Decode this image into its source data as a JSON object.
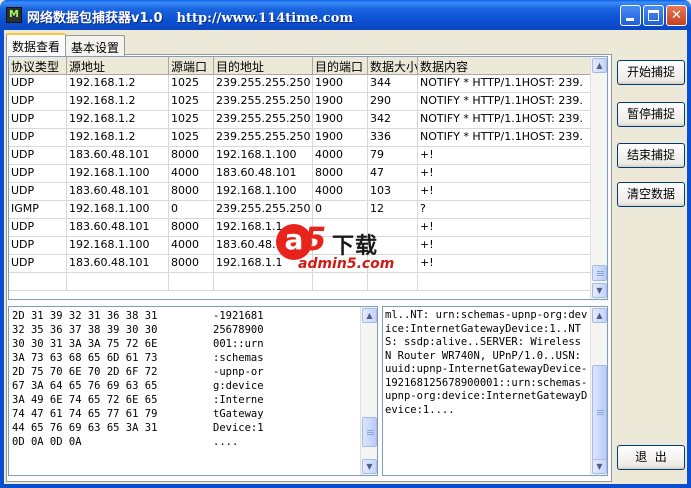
{
  "window": {
    "title": "网络数据包捕获器v1.0",
    "title_url": "http://www.114time.com",
    "icon_glyph": "M"
  },
  "tabs": [
    {
      "label": "数据查看",
      "active": true
    },
    {
      "label": "基本设置",
      "active": false
    }
  ],
  "table": {
    "columns": [
      "协议类型",
      "源地址",
      "源端口",
      "目的地址",
      "目的端口",
      "数据大小",
      "数据内容"
    ],
    "rows": [
      [
        "UDP",
        "192.168.1.2",
        "1025",
        "239.255.255.250",
        "1900",
        "344",
        "NOTIFY * HTTP/1.1HOST: 239."
      ],
      [
        "UDP",
        "192.168.1.2",
        "1025",
        "239.255.255.250",
        "1900",
        "290",
        "NOTIFY * HTTP/1.1HOST: 239."
      ],
      [
        "UDP",
        "192.168.1.2",
        "1025",
        "239.255.255.250",
        "1900",
        "342",
        "NOTIFY * HTTP/1.1HOST: 239."
      ],
      [
        "UDP",
        "192.168.1.2",
        "1025",
        "239.255.255.250",
        "1900",
        "336",
        "NOTIFY * HTTP/1.1HOST: 239."
      ],
      [
        "UDP",
        "183.60.48.101",
        "8000",
        "192.168.1.100",
        "4000",
        "79",
        " +!"
      ],
      [
        "UDP",
        "192.168.1.100",
        "4000",
        "183.60.48.101",
        "8000",
        "47",
        " +!"
      ],
      [
        "UDP",
        "183.60.48.101",
        "8000",
        "192.168.1.100",
        "4000",
        "103",
        " +!"
      ],
      [
        "IGMP",
        "192.168.1.100",
        "0",
        "239.255.255.250",
        "0",
        "12",
        "?"
      ],
      [
        "UDP",
        "183.60.48.101",
        "8000",
        "192.168.1.1",
        "",
        "",
        " +!"
      ],
      [
        "UDP",
        "192.168.1.100",
        "4000",
        "183.60.48.1",
        "",
        "",
        " +!"
      ],
      [
        "UDP",
        "183.60.48.101",
        "8000",
        "192.168.1.1",
        "",
        "",
        " +!"
      ],
      [
        "",
        "",
        "",
        "",
        "",
        "",
        ""
      ]
    ]
  },
  "hex_view": {
    "hex_lines": [
      "2D 31 39 32 31 36 38 31",
      "32 35 36 37 38 39 30 30",
      "30 30 31 3A 3A 75 72 6E",
      "3A 73 63 68 65 6D 61 73",
      "2D 75 70 6E 70 2D 6F 72",
      "67 3A 64 65 76 69 63 65",
      "3A 49 6E 74 65 72 6E 65",
      "74 47 61 74 65 77 61 79",
      "44 65 76 69 63 65 3A 31",
      "0D 0A 0D 0A"
    ],
    "ascii_lines": [
      "-1921681",
      "25678900",
      "001::urn",
      ":schemas",
      "-upnp-or",
      "g:device",
      ":Interne",
      "tGateway",
      "Device:1",
      "...."
    ]
  },
  "text_view": {
    "content": "ml..NT: urn:schemas-upnp-org:device:InternetGatewayDevice:1..NTS: ssdp:alive..SERVER: Wireless N Router WR740N, UPnP/1.0..USN: uuid:upnp-InternetGatewayDevice-192168125678900001::urn:schemas-upnp-org:device:InternetGatewayDevice:1...."
  },
  "buttons": {
    "start": "开始捕捉",
    "pause": "暂停捕捉",
    "stop": "结束捕捉",
    "clear": "清空数据",
    "exit": "退  出"
  },
  "watermark": {
    "a": "a",
    "five": "5",
    "cn": "下载",
    "site": "admin5.com"
  },
  "colors": {
    "titlebar": "#0b4fd0",
    "window_bg": "#ece9d8",
    "watermark_red": "#e8231c"
  }
}
